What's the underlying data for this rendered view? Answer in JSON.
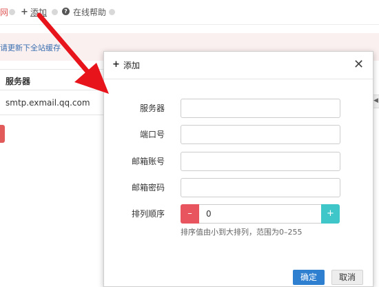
{
  "topbar": {
    "left_partial": "网",
    "add_label": "添加",
    "help_label": "在线帮助"
  },
  "notice": {
    "link": "请更新下全站缓存"
  },
  "table": {
    "header": "服务器",
    "rows": [
      "smtp.exmail.qq.com"
    ]
  },
  "modal": {
    "title": "添加",
    "fields": {
      "server": {
        "label": "服务器",
        "value": ""
      },
      "port": {
        "label": "端口号",
        "value": ""
      },
      "account": {
        "label": "邮箱账号",
        "value": ""
      },
      "password": {
        "label": "邮箱密码",
        "value": ""
      },
      "order": {
        "label": "排列顺序",
        "value": "0"
      }
    },
    "order_hint": "排序值由小到大排列，范围为0–255",
    "ok_label": "确定",
    "cancel_label": "取消"
  },
  "colors": {
    "primary": "#2f7fd1",
    "minus": "#e8555e",
    "plus": "#3fc6c9",
    "arrow": "#e8141c"
  },
  "icons": [
    "plus-icon",
    "help-icon",
    "close-icon",
    "minus-icon"
  ]
}
